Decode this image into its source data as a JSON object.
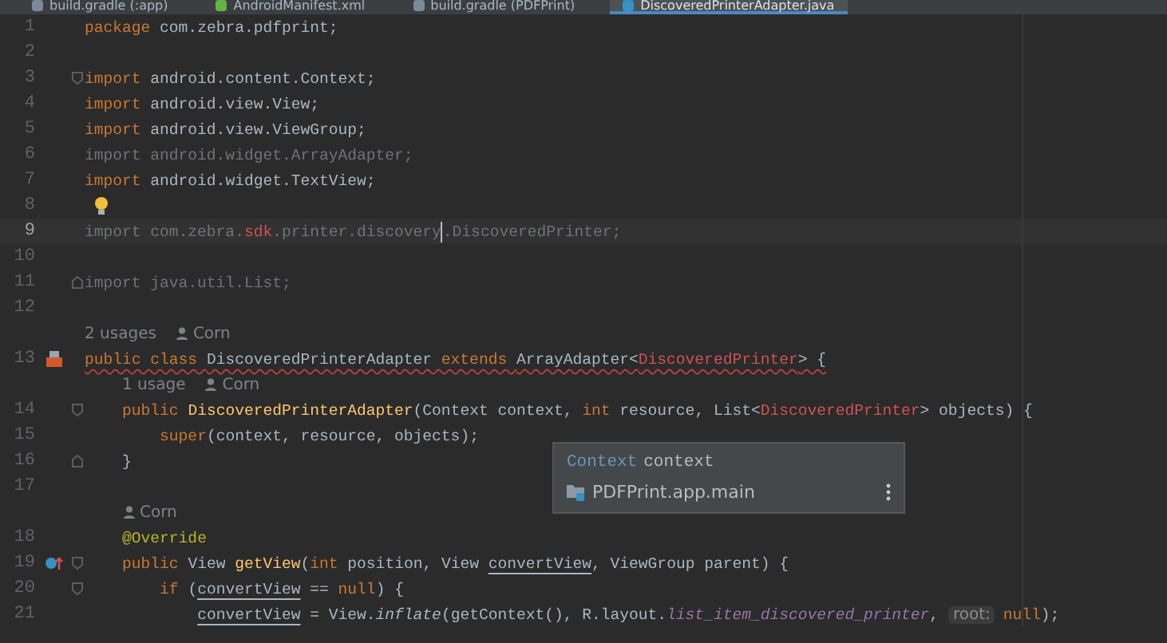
{
  "tabs": [
    {
      "label": "build.gradle (:app)",
      "selected": false
    },
    {
      "label": "AndroidManifest.xml",
      "selected": false
    },
    {
      "label": "build.gradle (PDFPrint)",
      "selected": false
    },
    {
      "label": "DiscoveredPrinterAdapter.java",
      "selected": true
    }
  ],
  "lines": [
    {
      "number": "1",
      "current": false,
      "error": false,
      "tokens": [
        {
          "kind": "kw",
          "text": "package "
        },
        {
          "kind": "plain",
          "text": "com.zebra.pdfprint;"
        }
      ]
    },
    {
      "number": "2",
      "current": false
    },
    {
      "number": "3",
      "current": false,
      "error": false,
      "markers": [
        {
          "kind": "fold-start"
        }
      ],
      "tokens": [
        {
          "kind": "kw",
          "text": "import "
        },
        {
          "kind": "plain",
          "text": "android.content.Context;"
        }
      ]
    },
    {
      "number": "4",
      "current": false,
      "error": false,
      "tokens": [
        {
          "kind": "kw",
          "text": "import "
        },
        {
          "kind": "plain",
          "text": "android.view.View;"
        }
      ]
    },
    {
      "number": "5",
      "current": false,
      "error": false,
      "tokens": [
        {
          "kind": "kw",
          "text": "import "
        },
        {
          "kind": "plain",
          "text": "android.view.ViewGroup;"
        }
      ]
    },
    {
      "number": "6",
      "current": false,
      "error": false,
      "tokens": [
        {
          "kind": "dim",
          "text": "import android.widget.ArrayAdapter;"
        }
      ]
    },
    {
      "number": "7",
      "current": false,
      "error": false,
      "tokens": [
        {
          "kind": "kw",
          "text": "import "
        },
        {
          "kind": "plain",
          "text": "android.widget.TextView;"
        }
      ]
    },
    {
      "number": "8",
      "current": false,
      "markers": [
        {
          "kind": "bulb"
        }
      ]
    },
    {
      "number": "9",
      "current": true,
      "error": false,
      "tokens": [
        {
          "kind": "dim",
          "text": "import com.zebra."
        },
        {
          "kind": "err",
          "text": "sdk"
        },
        {
          "kind": "dim",
          "text": ".printer.discovery"
        },
        {
          "kind": "caret"
        },
        {
          "kind": "dim",
          "text": ".DiscoveredPrinter;"
        }
      ]
    },
    {
      "number": "10",
      "current": false
    },
    {
      "number": "11",
      "current": false,
      "error": false,
      "markers": [
        {
          "kind": "fold-end"
        }
      ],
      "tokens": [
        {
          "kind": "dim",
          "text": "import java.util.List;"
        }
      ]
    },
    {
      "number": "12",
      "current": false
    },
    {
      "number": "13",
      "current": false,
      "error": true,
      "markers": [
        {
          "kind": "class"
        }
      ],
      "inlay": {
        "usages": "2 usages",
        "author": "Corn"
      },
      "tokens": [
        {
          "kind": "kw",
          "text": "public class "
        },
        {
          "kind": "plain",
          "text": "DiscoveredPrinterAdapter "
        },
        {
          "kind": "kw",
          "text": "extends "
        },
        {
          "kind": "plain",
          "text": "ArrayAdapter<"
        },
        {
          "kind": "err",
          "text": "DiscoveredPrinter"
        },
        {
          "kind": "plain",
          "text": "> {"
        }
      ]
    },
    {
      "number": "14",
      "current": false,
      "error": false,
      "markers": [
        {
          "kind": "fold-start"
        }
      ],
      "inlay": {
        "usages": "1 usage",
        "author": "Corn"
      },
      "tokens": [
        {
          "kind": "kw",
          "text": "    public "
        },
        {
          "kind": "decl",
          "text": "DiscoveredPrinterAdapter"
        },
        {
          "kind": "plain",
          "text": "(Context context, "
        },
        {
          "kind": "kw",
          "text": "int "
        },
        {
          "kind": "plain",
          "text": "resource, List<"
        },
        {
          "kind": "err",
          "text": "DiscoveredPrinter"
        },
        {
          "kind": "plain",
          "text": "> objects) {"
        }
      ]
    },
    {
      "number": "15",
      "current": false,
      "error": false,
      "tokens": [
        {
          "kind": "kw",
          "text": "        super"
        },
        {
          "kind": "plain",
          "text": "(context, resource, objects);"
        }
      ]
    },
    {
      "number": "16",
      "current": false,
      "error": false,
      "markers": [
        {
          "kind": "fold-end"
        }
      ],
      "tokens": [
        {
          "kind": "plain",
          "text": "    }"
        }
      ]
    },
    {
      "number": "17",
      "current": false
    },
    {
      "number": "18",
      "current": false,
      "error": false,
      "inlay": {
        "author": "Corn"
      },
      "tokens": [
        {
          "kind": "ann",
          "text": "    @Override"
        }
      ]
    },
    {
      "number": "19",
      "current": false,
      "error": false,
      "markers": [
        {
          "kind": "override"
        },
        {
          "kind": "fold-start"
        }
      ],
      "tokens": [
        {
          "kind": "kw",
          "text": "    public "
        },
        {
          "kind": "plain",
          "text": "View "
        },
        {
          "kind": "decl",
          "text": "getView"
        },
        {
          "kind": "plain",
          "text": "("
        },
        {
          "kind": "kw",
          "text": "int "
        },
        {
          "kind": "plain",
          "text": "position, View "
        },
        {
          "kind": "under",
          "text": "convertView"
        },
        {
          "kind": "plain",
          "text": ", ViewGroup parent) {"
        }
      ]
    },
    {
      "number": "20",
      "current": false,
      "error": false,
      "markers": [
        {
          "kind": "fold-start"
        }
      ],
      "tokens": [
        {
          "kind": "kw",
          "text": "        if "
        },
        {
          "kind": "plain",
          "text": "("
        },
        {
          "kind": "under",
          "text": "convertView"
        },
        {
          "kind": "plain",
          "text": " == "
        },
        {
          "kind": "kw",
          "text": "null"
        },
        {
          "kind": "plain",
          "text": ") {"
        }
      ]
    },
    {
      "number": "21",
      "current": false,
      "error": false,
      "tokens": [
        {
          "kind": "under",
          "text": "            convertView"
        },
        {
          "kind": "plain",
          "text": " = View."
        },
        {
          "kind": "italic",
          "text": "inflate"
        },
        {
          "kind": "plain",
          "text": "(getContext(), R.layout."
        },
        {
          "kind": "field",
          "text": "list_item_discovered_printer"
        },
        {
          "kind": "plain",
          "text": ", "
        },
        {
          "kind": "hint",
          "text": "root:"
        },
        {
          "kind": "kw",
          "text": "null"
        },
        {
          "kind": "plain",
          "text": ");"
        }
      ]
    }
  ],
  "popup": {
    "type": "Context",
    "name": "context",
    "module": "PDFPrint.app.main"
  }
}
